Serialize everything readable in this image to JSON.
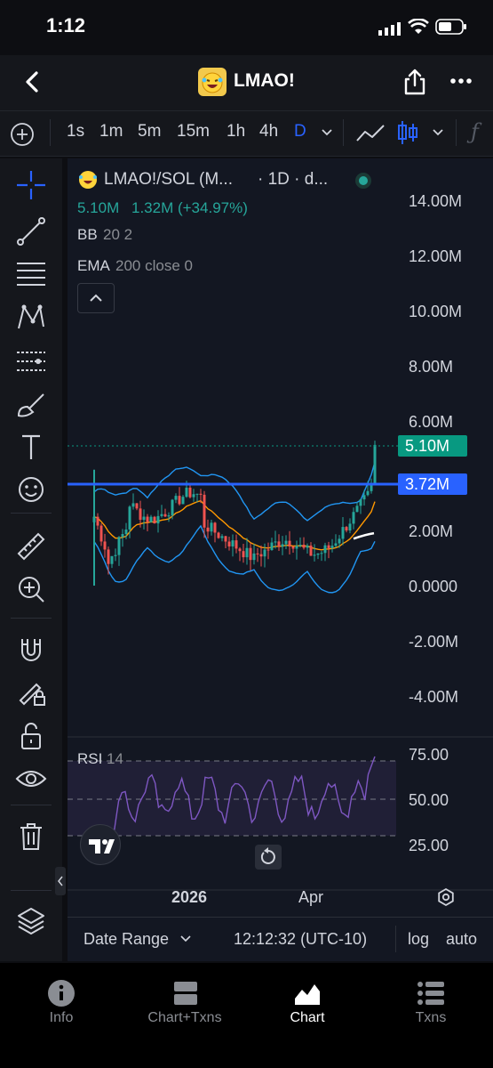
{
  "status_bar": {
    "time": "1:12"
  },
  "header": {
    "title": "LMAO!",
    "back_icon": "chevron-left-icon",
    "share_icon": "share-icon",
    "more_icon": "more-icon",
    "token_icon": "laughing-emoji-icon"
  },
  "toolbar": {
    "timeframes": [
      "1s",
      "1m",
      "5m",
      "15m",
      "1h",
      "4h",
      "D"
    ],
    "active_timeframe": "D",
    "add_icon": "plus-circle-icon",
    "dropdown_icon": "chevron-down-icon",
    "line_chart_icon": "line-chart-icon",
    "candles_icon": "candlestick-icon",
    "indicators_icon": "function-icon"
  },
  "left_tools": [
    "crosshair-icon",
    "trendline-icon",
    "horizontal-lines-icon",
    "pattern-icon",
    "prediction-icon",
    "brush-icon",
    "text-icon",
    "emoji-icon",
    "ruler-icon",
    "zoom-in-icon",
    "magnet-icon",
    "lock-draw-icon",
    "lock-icon",
    "eye-icon",
    "trash-icon",
    "layers-icon"
  ],
  "legend": {
    "symbol": "LMAO!/SOL (M...",
    "interval": "· 1D · d...",
    "last_value": "5.10M",
    "change": "1.32M (+34.97%)",
    "bb_label": "BB",
    "bb_params": "20 2",
    "ema_label": "EMA",
    "ema_params": "200 close 0",
    "collapse_icon": "chevron-up-icon",
    "status_color": "#26a69a"
  },
  "price_axis": [
    "14.00M",
    "12.00M",
    "10.00M",
    "8.00M",
    "6.00M",
    "2.00M",
    "0.0000",
    "-2.00M",
    "-4.00M"
  ],
  "price_tags": {
    "current": "5.10M",
    "line": "3.72M",
    "current_color": "#089981",
    "line_color": "#2962ff"
  },
  "rsi": {
    "label": "RSI",
    "period": "14",
    "levels": [
      "75.00",
      "50.00",
      "25.00"
    ]
  },
  "time_axis": {
    "labels": [
      "2026",
      "Apr"
    ]
  },
  "bottom_bar": {
    "date_range": "Date Range",
    "time": "12:12:32 (UTC-10)",
    "log": "log",
    "auto": "auto"
  },
  "tabs": [
    {
      "label": "Info",
      "icon": "info-icon"
    },
    {
      "label": "Chart+Txns",
      "icon": "split-view-icon"
    },
    {
      "label": "Chart",
      "icon": "area-chart-icon"
    },
    {
      "label": "Txns",
      "icon": "list-icon"
    }
  ],
  "active_tab": "Chart",
  "colors": {
    "up": "#26a69a",
    "down": "#ef5350",
    "bb": "#2196f3",
    "ema": "#ff9800",
    "rsi": "#7e57c2",
    "accent": "#2962ff"
  }
}
